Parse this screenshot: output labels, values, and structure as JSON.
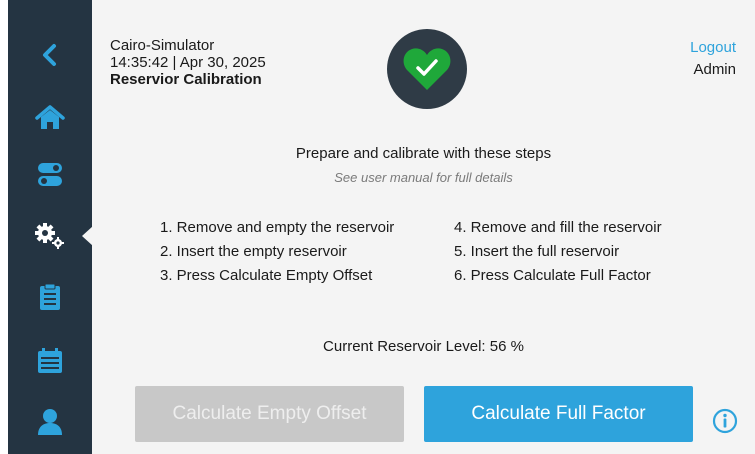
{
  "header": {
    "app_name": "Cairo-Simulator",
    "datetime": "14:35:42 | Apr 30, 2025",
    "page_title": "Reservior Calibration",
    "status_icon": "heart-check-icon",
    "status_color": "#1fa83a",
    "logout_label": "Logout",
    "username": "Admin"
  },
  "sidebar": {
    "background": "#243442",
    "items": [
      {
        "name": "back",
        "icon": "chevron-left-icon"
      },
      {
        "name": "home",
        "icon": "home-icon"
      },
      {
        "name": "toggles",
        "icon": "toggle-icon"
      },
      {
        "name": "settings",
        "icon": "gears-icon",
        "active": true
      },
      {
        "name": "log",
        "icon": "clipboard-icon"
      },
      {
        "name": "calendar",
        "icon": "calendar-icon"
      },
      {
        "name": "user",
        "icon": "user-icon"
      }
    ]
  },
  "instructions": {
    "title": "Prepare and calibrate with these steps",
    "subtitle": "See user manual for full details",
    "steps": [
      "1. Remove and empty the reservoir",
      "2. Insert the empty reservoir",
      "3. Press Calculate Empty Offset",
      "4. Remove and fill the reservoir",
      "5. Insert the full reservoir",
      "6. Press Calculate Full Factor"
    ]
  },
  "reservoir": {
    "label": "Current Reservoir Level:",
    "value": "56 %"
  },
  "actions": {
    "empty_label": "Calculate Empty Offset",
    "full_label": "Calculate Full Factor",
    "info_icon": "info-icon",
    "accent": "#2ea3dc",
    "disabled": "#c8c8c8"
  }
}
